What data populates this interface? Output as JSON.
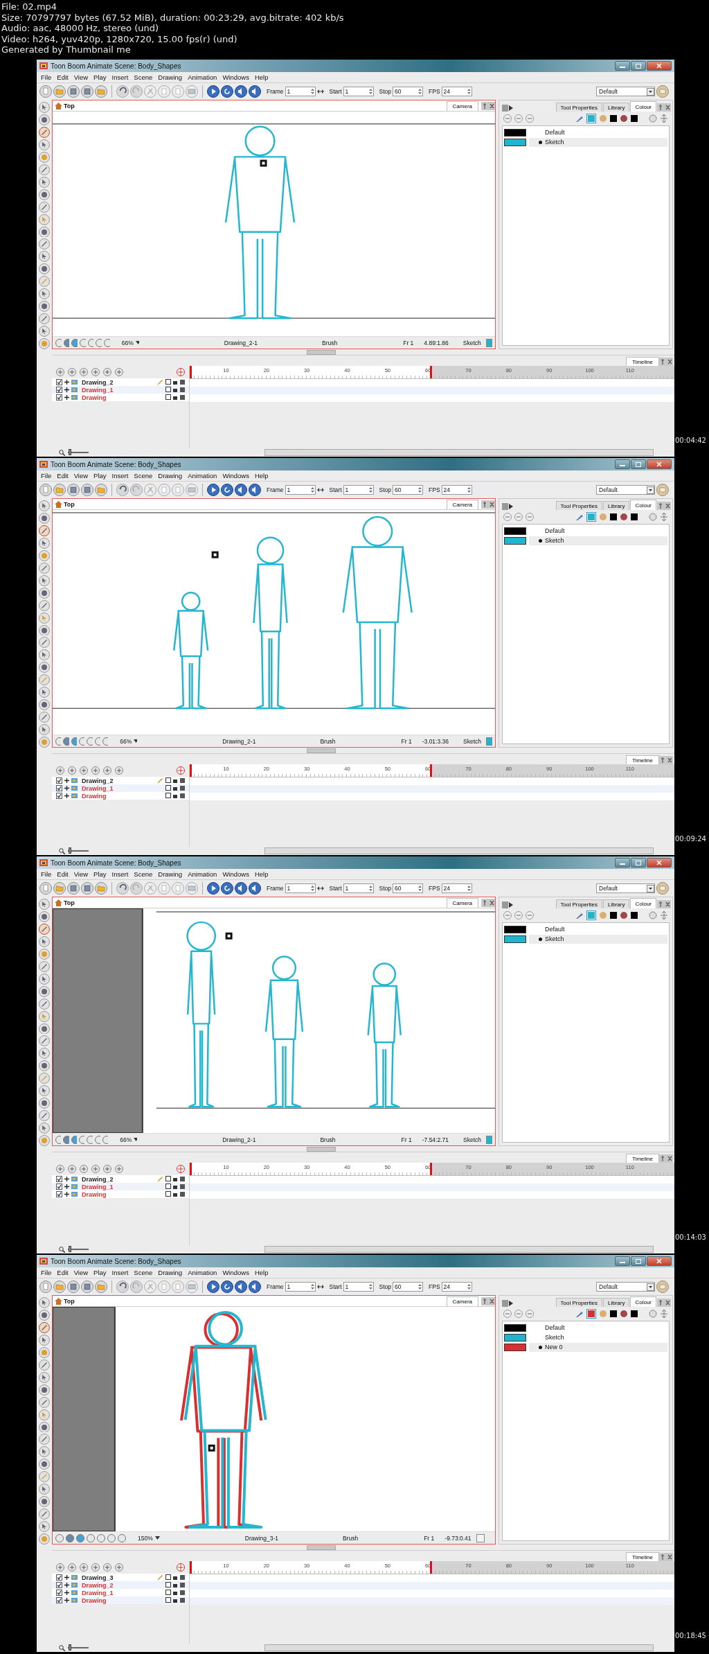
{
  "file_info": [
    "File: 02.mp4",
    "Size: 70797797 bytes (67.52 MiB), duration: 00:23:29, avg.bitrate: 402 kb/s",
    "Audio: aac, 48000 Hz, stereo (und)",
    "Video: h264, yuv420p, 1280x720, 15.00 fps(r) (und)",
    "Generated by Thumbnail me"
  ],
  "frames": [
    {
      "timestamp": "00:04:42",
      "window_title": "Toon Boom Animate Scene: Body_Shapes",
      "menu": [
        "File",
        "Edit",
        "View",
        "Play",
        "Insert",
        "Scene",
        "Drawing",
        "Animation",
        "Windows",
        "Help"
      ],
      "toolbar": {
        "fields": [
          {
            "label": "Frame",
            "value": "1"
          },
          {
            "label": "Start",
            "value": "1"
          },
          {
            "label": "Stop",
            "value": "60"
          },
          {
            "label": "FPS",
            "value": "24"
          }
        ],
        "workspace": "Default"
      },
      "camera_view": {
        "breadcrumb": "Top",
        "tab": "Camera",
        "offstage_area": false,
        "status": {
          "zoom": "66%",
          "drawing": "Drawing_2-1",
          "tool": "Brush",
          "frame": "Fr 1",
          "coords": "4.89:1.86",
          "colour_name": "Sketch"
        }
      },
      "side_panel": {
        "tabs": [
          {
            "label": "Tool Properties",
            "selected": false
          },
          {
            "label": "Library",
            "selected": false
          },
          {
            "label": "Colour",
            "selected": true
          }
        ],
        "colours": [
          {
            "name": "Default",
            "color": "#000000",
            "selected": false
          },
          {
            "name": "Sketch",
            "color": "#20b4cf",
            "selected": true
          }
        ]
      },
      "timeline": {
        "tab": "Timeline",
        "ruler": [
          "10",
          "20",
          "30",
          "40",
          "50",
          "60",
          "70",
          "80",
          "90",
          "100",
          "110"
        ],
        "layers": [
          {
            "name": "Drawing_2",
            "color": "#222222",
            "checked": true,
            "selected": true
          },
          {
            "name": "Drawing_1",
            "color": "#e03030",
            "checked": true,
            "selected": false
          },
          {
            "name": "Drawing",
            "color": "#e03030",
            "checked": true,
            "selected": false
          }
        ],
        "zoom_slider": {
          "level": 0.1
        }
      }
    },
    {
      "timestamp": "00:09:24",
      "window_title": "Toon Boom Animate Scene: Body_Shapes",
      "menu": [
        "File",
        "Edit",
        "View",
        "Play",
        "Insert",
        "Scene",
        "Drawing",
        "Animation",
        "Windows",
        "Help"
      ],
      "toolbar": {
        "fields": [
          {
            "label": "Frame",
            "value": "1"
          },
          {
            "label": "Start",
            "value": "1"
          },
          {
            "label": "Stop",
            "value": "60"
          },
          {
            "label": "FPS",
            "value": "24"
          }
        ],
        "workspace": "Default"
      },
      "camera_view": {
        "breadcrumb": "Top",
        "tab": "Camera",
        "offstage_area": false,
        "status": {
          "zoom": "66%",
          "drawing": "Drawing_2-1",
          "tool": "Brush",
          "frame": "Fr 1",
          "coords": "-3.01:3.36",
          "colour_name": "Sketch"
        }
      },
      "side_panel": {
        "tabs": [
          {
            "label": "Tool Properties",
            "selected": false
          },
          {
            "label": "Library",
            "selected": false
          },
          {
            "label": "Colour",
            "selected": true
          }
        ],
        "colours": [
          {
            "name": "Default",
            "color": "#000000",
            "selected": false
          },
          {
            "name": "Sketch",
            "color": "#20b4cf",
            "selected": true
          }
        ]
      },
      "timeline": {
        "tab": "Timeline",
        "ruler": [
          "10",
          "20",
          "30",
          "40",
          "50",
          "60",
          "70",
          "80",
          "90",
          "100",
          "110"
        ],
        "layers": [
          {
            "name": "Drawing_2",
            "color": "#222222",
            "checked": true,
            "selected": true
          },
          {
            "name": "Drawing_1",
            "color": "#e03030",
            "checked": true,
            "selected": false
          },
          {
            "name": "Drawing",
            "color": "#e03030",
            "checked": true,
            "selected": false
          }
        ],
        "zoom_slider": {
          "level": 0.1
        }
      }
    },
    {
      "timestamp": "00:14:03",
      "window_title": "Toon Boom Animate Scene: Body_Shapes",
      "menu": [
        "File",
        "Edit",
        "View",
        "Play",
        "Insert",
        "Scene",
        "Drawing",
        "Animation",
        "Windows",
        "Help"
      ],
      "toolbar": {
        "fields": [
          {
            "label": "Frame",
            "value": "1"
          },
          {
            "label": "Start",
            "value": "1"
          },
          {
            "label": "Stop",
            "value": "60"
          },
          {
            "label": "FPS",
            "value": "24"
          }
        ],
        "workspace": "Default"
      },
      "camera_view": {
        "breadcrumb": "Top",
        "tab": "Camera",
        "offstage_area": true,
        "status": {
          "zoom": "66%",
          "drawing": "Drawing_2-1",
          "tool": "Brush",
          "frame": "Fr 1",
          "coords": "-7.54:2.71",
          "colour_name": "Sketch"
        }
      },
      "side_panel": {
        "tabs": [
          {
            "label": "Tool Properties",
            "selected": false
          },
          {
            "label": "Library",
            "selected": false
          },
          {
            "label": "Colour",
            "selected": true
          }
        ],
        "colours": [
          {
            "name": "Default",
            "color": "#000000",
            "selected": false
          },
          {
            "name": "Sketch",
            "color": "#20b4cf",
            "selected": true
          }
        ]
      },
      "timeline": {
        "tab": "Timeline",
        "ruler": [
          "10",
          "20",
          "30",
          "40",
          "50",
          "60",
          "70",
          "80",
          "90",
          "100",
          "110"
        ],
        "layers": [
          {
            "name": "Drawing_2",
            "color": "#222222",
            "checked": true,
            "selected": true
          },
          {
            "name": "Drawing_1",
            "color": "#e03030",
            "checked": true,
            "selected": false
          },
          {
            "name": "Drawing",
            "color": "#e03030",
            "checked": true,
            "selected": false
          }
        ],
        "zoom_slider": {
          "level": 0.1
        }
      }
    },
    {
      "timestamp": "00:18:45",
      "window_title": "Toon Boom Animate Scene: Body_Shapes",
      "menu": [
        "File",
        "Edit",
        "View",
        "Play",
        "Insert",
        "Scene",
        "Drawing",
        "Animation",
        "Windows",
        "Help"
      ],
      "toolbar": {
        "fields": [
          {
            "label": "Frame",
            "value": "1"
          },
          {
            "label": "Start",
            "value": "1"
          },
          {
            "label": "Stop",
            "value": "60"
          },
          {
            "label": "FPS",
            "value": "24"
          }
        ],
        "workspace": "Default"
      },
      "camera_view": {
        "breadcrumb": "Top",
        "tab": "Camera",
        "offstage_area": true,
        "status": {
          "zoom": "150%",
          "drawing": "Drawing_3-1",
          "tool": "Brush",
          "frame": "Fr 1",
          "coords": "-9.73:0.41"
        }
      },
      "side_panel": {
        "tabs": [
          {
            "label": "Tool Properties",
            "selected": false
          },
          {
            "label": "Library",
            "selected": false
          },
          {
            "label": "Colour",
            "selected": true
          }
        ],
        "colours": [
          {
            "name": "Default",
            "color": "#000000",
            "selected": false
          },
          {
            "name": "Sketch",
            "color": "#20b4cf",
            "selected": false
          },
          {
            "name": "New 0",
            "color": "#d83030",
            "selected": true
          }
        ]
      },
      "timeline": {
        "tab": "Timeline",
        "ruler": [
          "10",
          "20",
          "30",
          "40",
          "50",
          "60",
          "70",
          "80",
          "90",
          "100",
          "110"
        ],
        "layers": [
          {
            "name": "Drawing_3",
            "color": "#222222",
            "checked": true,
            "selected": true
          },
          {
            "name": "Drawing_2",
            "color": "#e03030",
            "checked": true,
            "selected": false
          },
          {
            "name": "Drawing_1",
            "color": "#e03030",
            "checked": true,
            "selected": false
          },
          {
            "name": "Drawing",
            "color": "#e03030",
            "checked": true,
            "selected": false
          }
        ],
        "zoom_slider": {
          "level": 0.1
        }
      }
    }
  ]
}
